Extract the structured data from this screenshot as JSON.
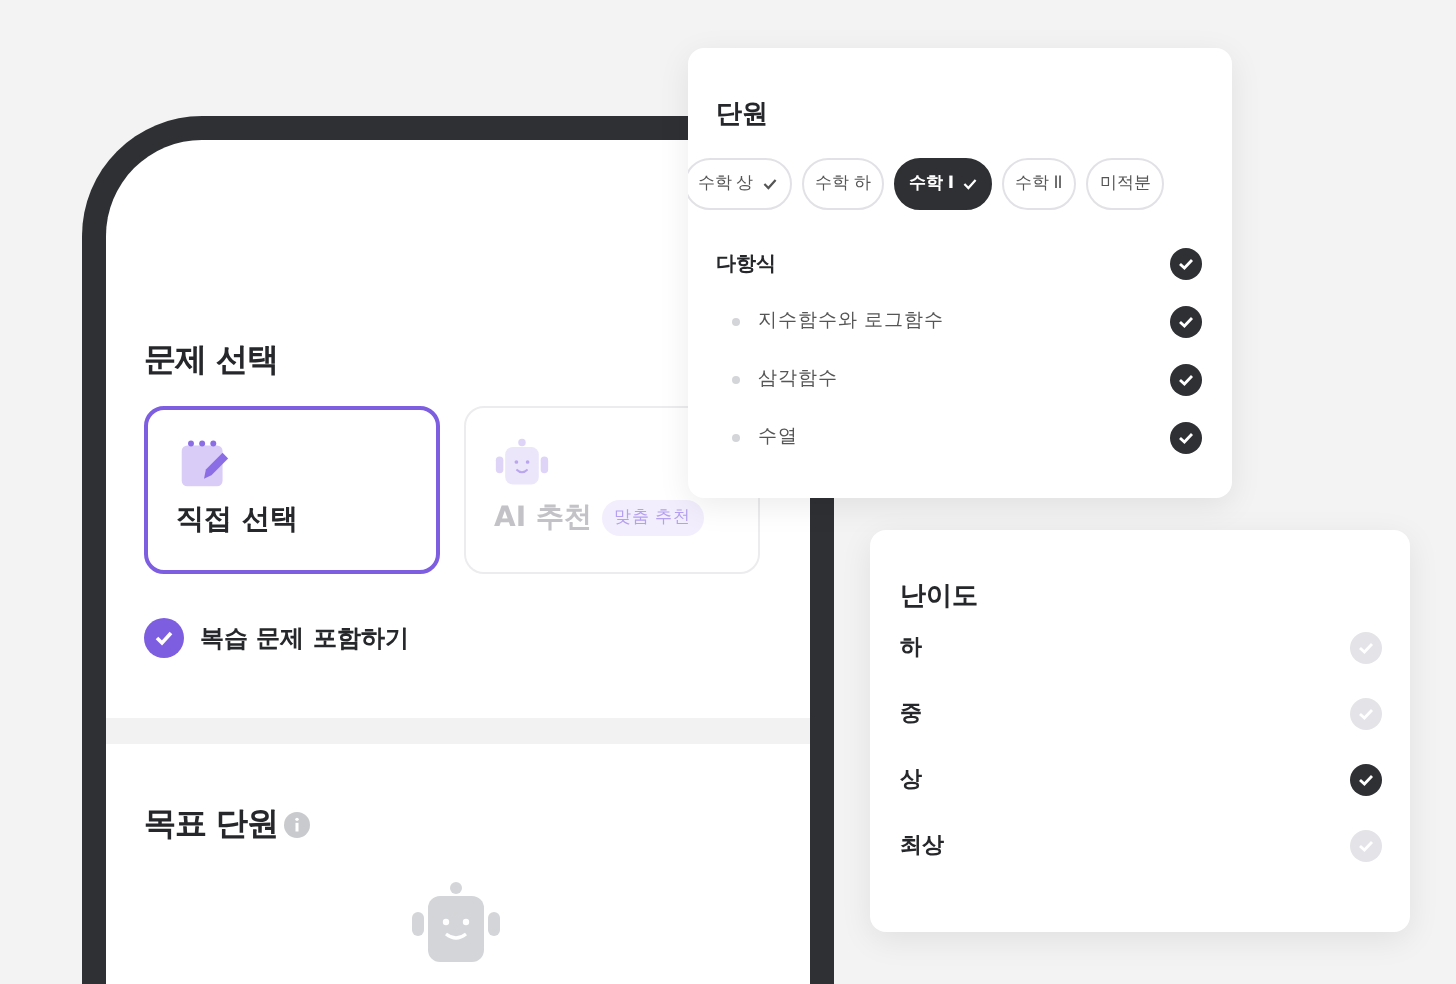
{
  "problem_select": {
    "title": "문제 선택",
    "options": [
      {
        "kind": "manual",
        "label": "직접 선택",
        "selected": true
      },
      {
        "kind": "ai",
        "label": "AI 추천",
        "badge": "맞춤 추천",
        "selected": false
      }
    ],
    "review": {
      "label": "복습 문제 포함하기",
      "checked": true
    }
  },
  "target_unit": {
    "title": "목표 단원"
  },
  "unit_popup": {
    "title": "단원",
    "chips": [
      {
        "label": "수학 상",
        "checked": true,
        "selected": false
      },
      {
        "label": "수학 하",
        "checked": false,
        "selected": false
      },
      {
        "label": "수학 I",
        "checked": true,
        "selected": true
      },
      {
        "label": "수학 II",
        "checked": false,
        "selected": false
      },
      {
        "label": "미적분",
        "checked": false,
        "selected": false
      }
    ],
    "topics": [
      {
        "label": "다항식",
        "checked": true,
        "children": [
          {
            "label": "지수함수와 로그함수",
            "checked": true
          },
          {
            "label": "삼각함수",
            "checked": true
          },
          {
            "label": "수열",
            "checked": true
          }
        ]
      }
    ]
  },
  "difficulty_popup": {
    "title": "난이도",
    "levels": [
      {
        "label": "하",
        "checked": false
      },
      {
        "label": "중",
        "checked": false
      },
      {
        "label": "상",
        "checked": true
      },
      {
        "label": "최상",
        "checked": false
      }
    ]
  }
}
